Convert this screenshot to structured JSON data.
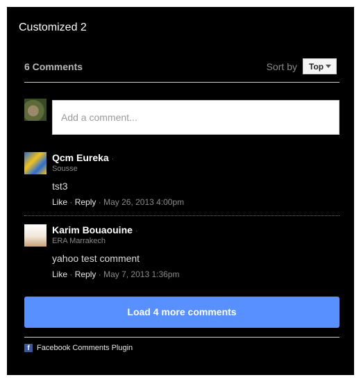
{
  "plugin": {
    "title": "Customized 2",
    "comment_count": "6 Comments",
    "sort_label": "Sort by",
    "sort_value": "Top",
    "input_placeholder": "Add a comment...",
    "load_more": "Load 4 more comments",
    "footer": "Facebook Comments Plugin"
  },
  "comments": [
    {
      "name": "Qcm Eureka",
      "location": "Sousse",
      "text": "tst3",
      "like": "Like",
      "reply": "Reply",
      "timestamp": "May 26, 2013 4:00pm"
    },
    {
      "name": "Karim Bouaouine",
      "location": "ERA Marrakech",
      "text": "yahoo test comment",
      "like": "Like",
      "reply": "Reply",
      "timestamp": "May 7, 2013 1:36pm"
    }
  ]
}
